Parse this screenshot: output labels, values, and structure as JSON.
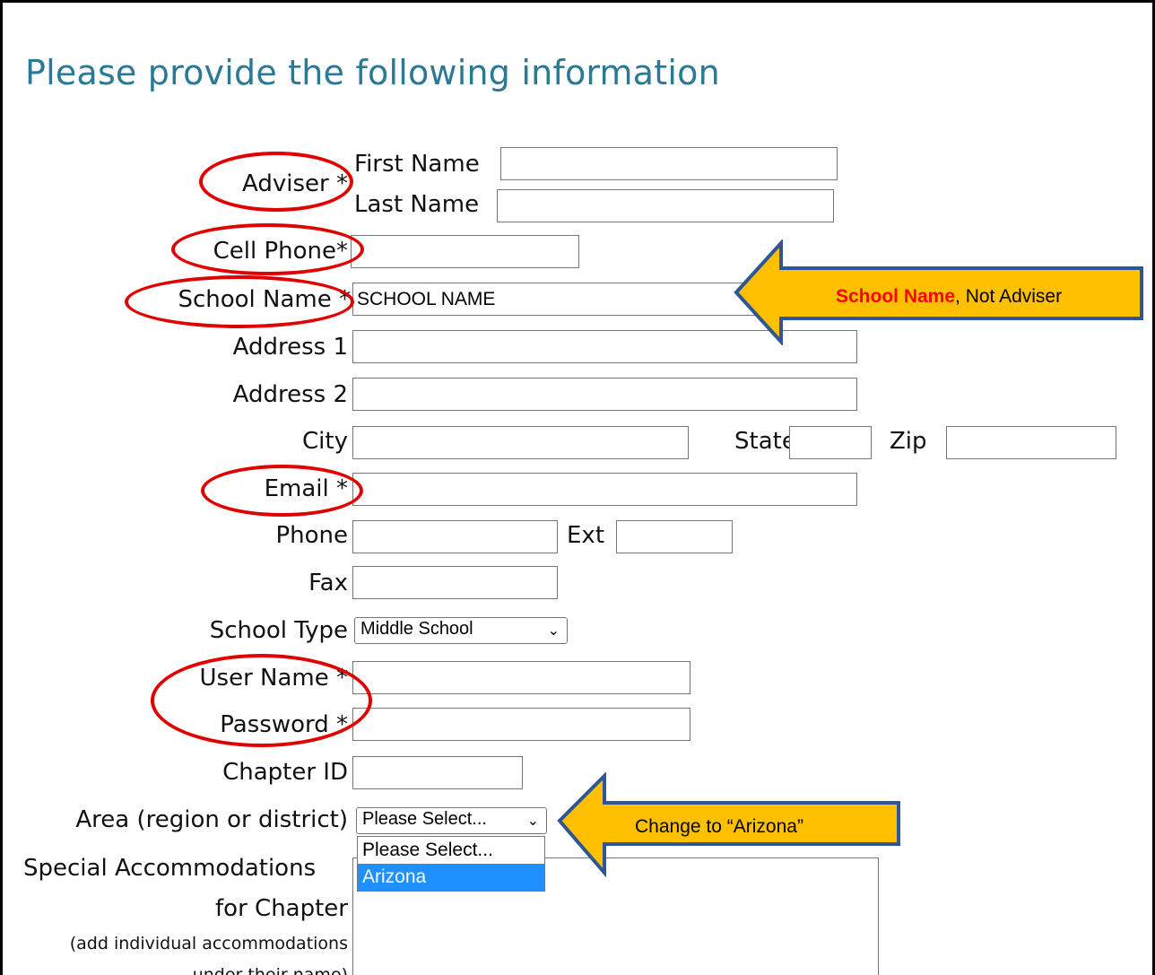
{
  "page": {
    "title": "Please provide the following information"
  },
  "adviser": {
    "label": "Adviser *",
    "first_name_label": "First Name",
    "first_name_value": "",
    "last_name_label": "Last Name",
    "last_name_value": ""
  },
  "cell_phone": {
    "label": "Cell Phone*",
    "value": ""
  },
  "school_name": {
    "label": "School Name *",
    "value": "SCHOOL NAME"
  },
  "address1": {
    "label": "Address 1",
    "value": ""
  },
  "address2": {
    "label": "Address 2",
    "value": ""
  },
  "city": {
    "label": "City",
    "value": ""
  },
  "state": {
    "label": "State",
    "value": ""
  },
  "zip": {
    "label": "Zip",
    "value": ""
  },
  "email": {
    "label": "Email *",
    "value": ""
  },
  "phone": {
    "label": "Phone",
    "value": ""
  },
  "ext": {
    "label": "Ext",
    "value": ""
  },
  "fax": {
    "label": "Fax",
    "value": ""
  },
  "school_type": {
    "label": "School Type",
    "selected": "Middle School"
  },
  "user_name": {
    "label": "User Name *",
    "value": ""
  },
  "password": {
    "label": "Password *",
    "value": ""
  },
  "chapter_id": {
    "label": "Chapter ID",
    "value": ""
  },
  "area": {
    "label": "Area (region or district)",
    "selected": "Please Select...",
    "options": [
      "Please Select...",
      "Arizona"
    ],
    "highlighted": "Arizona"
  },
  "special": {
    "label_line1": "Special Accommodations",
    "label_line2": "for Chapter",
    "note_line1": "(add individual accommodations",
    "note_line2": "under their name)"
  },
  "annotations": {
    "school_name_callout": {
      "bold": "School Name",
      "rest": ", Not Adviser"
    },
    "area_callout": "Change to “Arizona”"
  },
  "colors": {
    "heading": "#2a7a96",
    "ring": "#e00000",
    "callout_fill": "#ffc000",
    "callout_border": "#2f5597",
    "callout_bold": "#ff0000",
    "dropdown_highlight": "#1e90ff"
  }
}
